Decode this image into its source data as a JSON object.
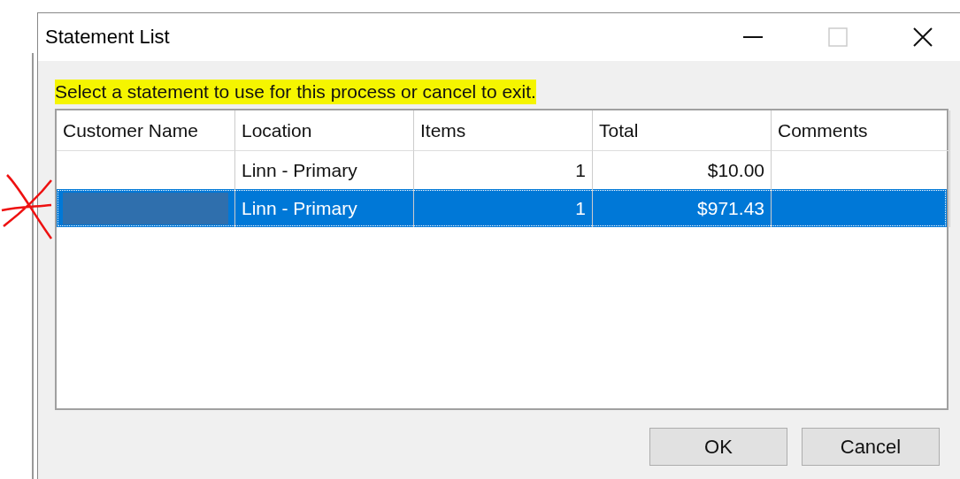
{
  "window": {
    "title": "Statement List",
    "caption_buttons": [
      {
        "kind": "minimize",
        "disabled": false
      },
      {
        "kind": "maximize",
        "disabled": true
      },
      {
        "kind": "close",
        "disabled": false
      }
    ]
  },
  "instruction": {
    "text": "Select a statement to use for this process or cancel to exit.",
    "highlighted": true
  },
  "table": {
    "columns": [
      {
        "label": "Customer Name"
      },
      {
        "label": "Location"
      },
      {
        "label": "Items"
      },
      {
        "label": "Total"
      },
      {
        "label": "Comments"
      }
    ],
    "rows": [
      {
        "selected": false,
        "cells": [
          "",
          "Linn - Primary",
          "1",
          "$10.00",
          ""
        ]
      },
      {
        "selected": true,
        "cells": [
          "",
          "Linn - Primary",
          "1",
          "$971.43",
          ""
        ]
      }
    ]
  },
  "buttons": [
    "OK",
    "Cancel"
  ]
}
